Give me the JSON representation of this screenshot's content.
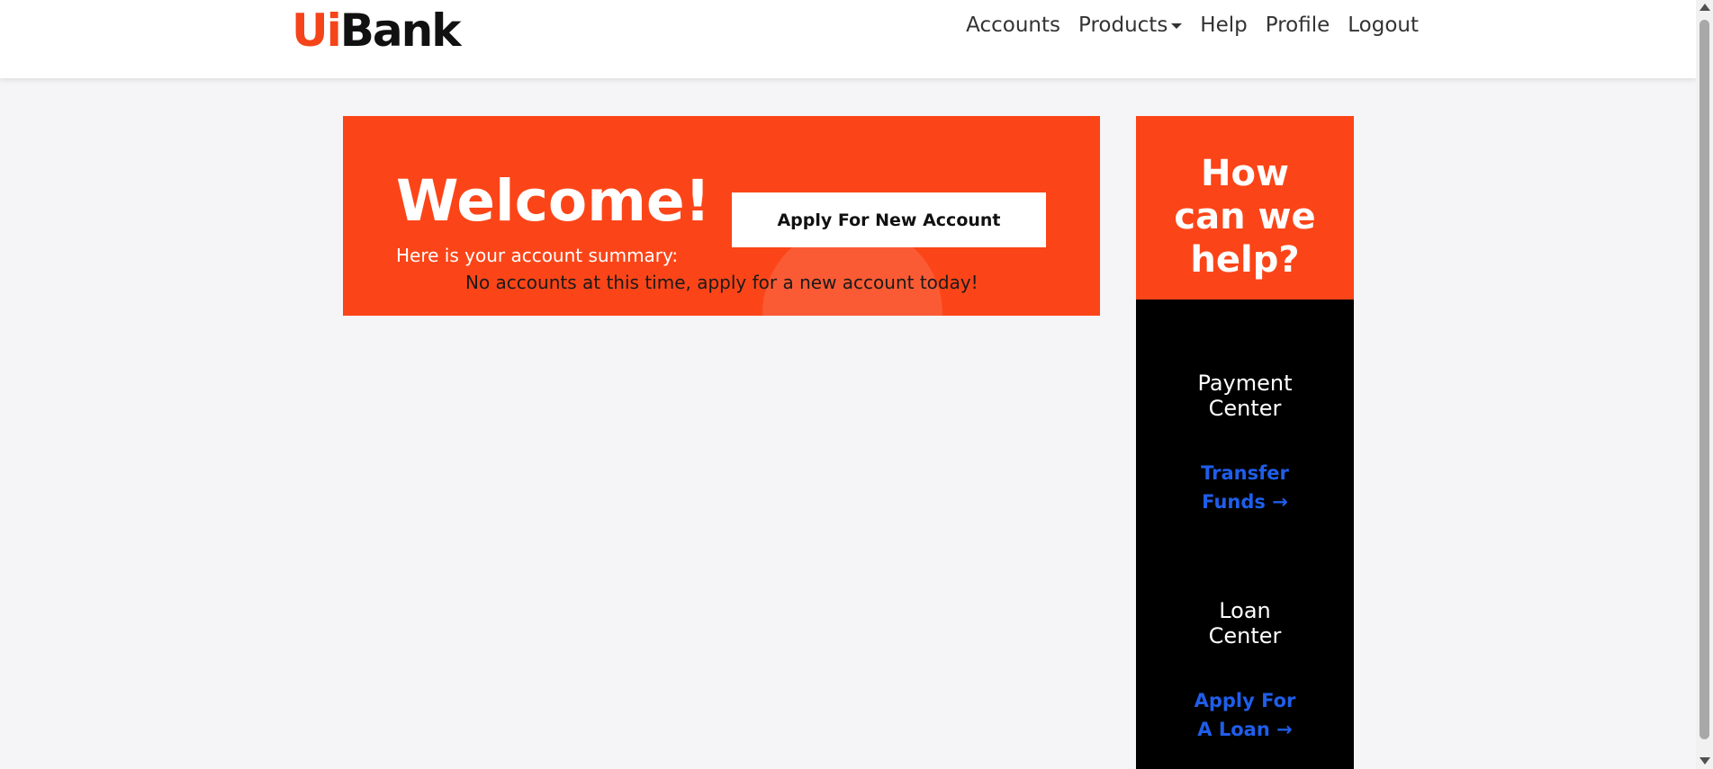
{
  "header": {
    "logo_ui": "Ui",
    "logo_bank": "Bank",
    "nav": {
      "accounts": "Accounts",
      "products": "Products",
      "help": "Help",
      "profile": "Profile",
      "logout": "Logout"
    }
  },
  "welcome": {
    "title": "Welcome!",
    "summary_label": "Here is your account summary:",
    "no_accounts_message": "No accounts at this time, apply for a new account today!",
    "apply_button": "Apply For New Account"
  },
  "help_panel": {
    "title_line1": "How",
    "title_line2": "can we",
    "title_line3": "help?",
    "payment_center_line1": "Payment",
    "payment_center_line2": "Center",
    "transfer_link_line1": "Transfer",
    "transfer_link_line2": "Funds →",
    "loan_center_line1": "Loan",
    "loan_center_line2": "Center",
    "loan_link_line1": "Apply For",
    "loan_link_line2": "A Loan →"
  },
  "colors": {
    "brand_orange": "#fb4518",
    "link_blue": "#1f5eea",
    "page_background": "#f5f5f8"
  }
}
